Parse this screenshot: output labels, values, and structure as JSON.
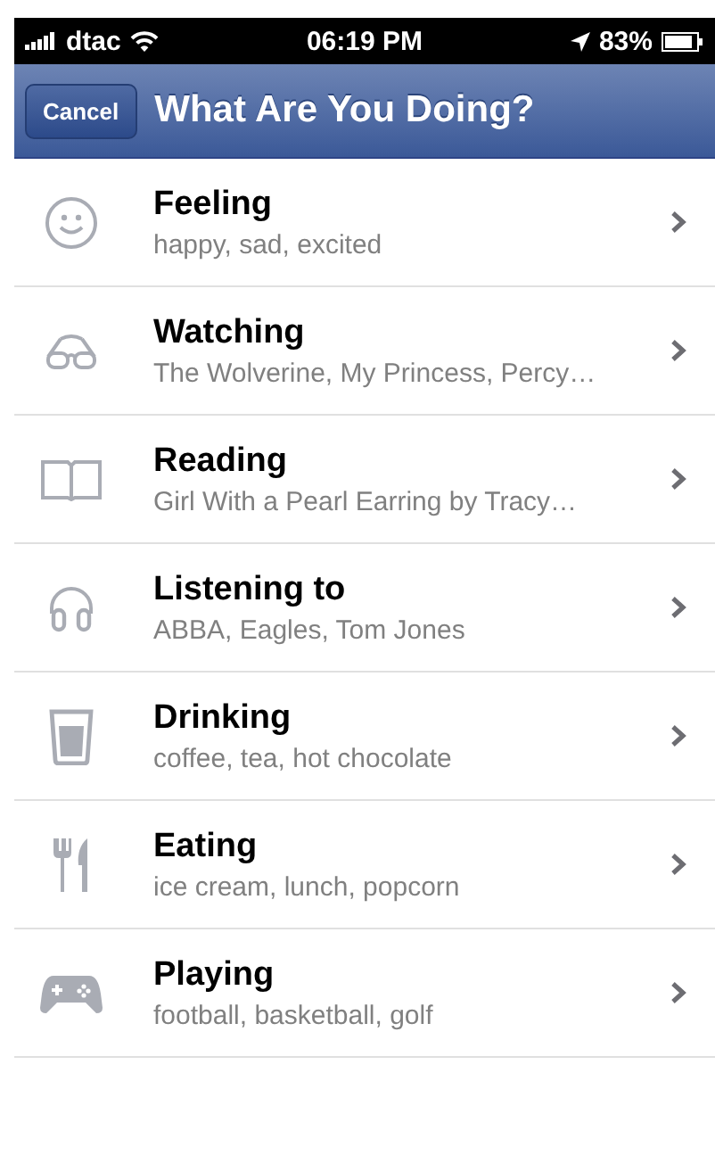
{
  "status_bar": {
    "carrier": "dtac",
    "time": "06:19 PM",
    "battery": "83%"
  },
  "nav_bar": {
    "cancel": "Cancel",
    "title": "What Are You Doing?"
  },
  "items": [
    {
      "title": "Feeling",
      "subtitle": "happy, sad, excited"
    },
    {
      "title": "Watching",
      "subtitle": "The Wolverine, My Princess, Percy…"
    },
    {
      "title": "Reading",
      "subtitle": "Girl With a Pearl Earring by Tracy…"
    },
    {
      "title": "Listening to",
      "subtitle": "ABBA, Eagles, Tom Jones"
    },
    {
      "title": "Drinking",
      "subtitle": "coffee, tea, hot chocolate"
    },
    {
      "title": "Eating",
      "subtitle": "ice cream, lunch, popcorn"
    },
    {
      "title": "Playing",
      "subtitle": "football, basketball, golf"
    }
  ]
}
